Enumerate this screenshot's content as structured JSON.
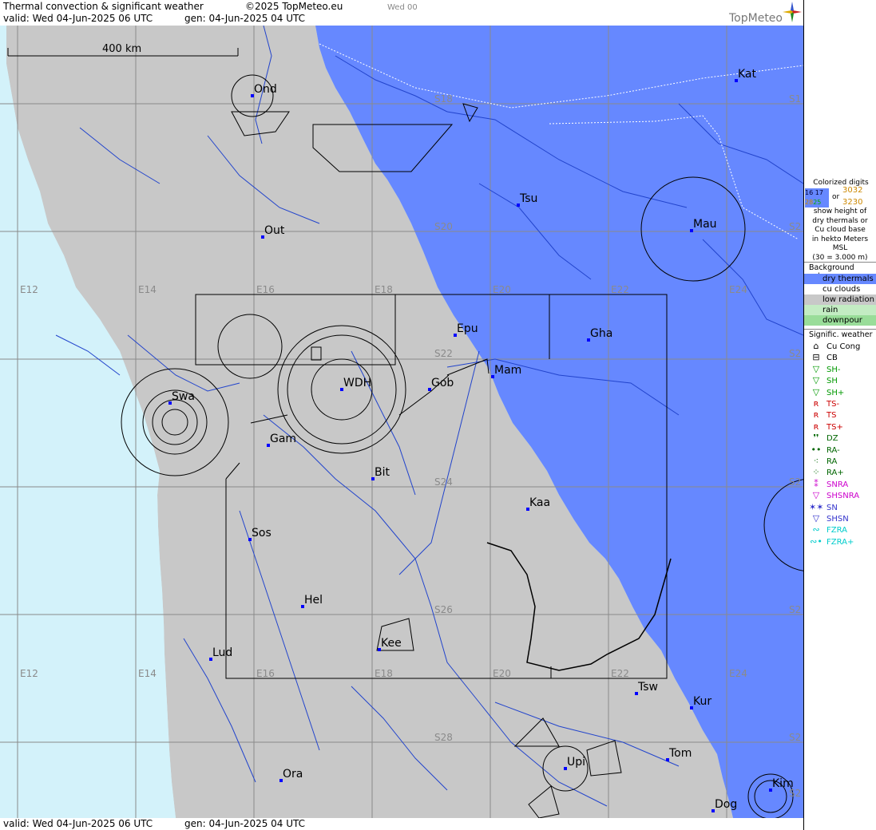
{
  "header": {
    "title": "Thermal convection & significant weather",
    "copyright": "©2025 TopMeteo.eu",
    "day_label": "Wed 00",
    "valid": "valid:  Wed  04-Jun-2025  06 UTC",
    "gen": "gen: 04-Jun-2025 04 UTC",
    "brand": "TopMeteo"
  },
  "scale": {
    "label": "400 km"
  },
  "stations": [
    {
      "code": "Ond"
    },
    {
      "code": "Out"
    },
    {
      "code": "Swa"
    },
    {
      "code": "WDH"
    },
    {
      "code": "Gam"
    },
    {
      "code": "Epu"
    },
    {
      "code": "Gob"
    },
    {
      "code": "Mam"
    },
    {
      "code": "Bit"
    },
    {
      "code": "Sos"
    },
    {
      "code": "Hel"
    },
    {
      "code": "Kee"
    },
    {
      "code": "Lud"
    },
    {
      "code": "Kaa"
    },
    {
      "code": "Tsu"
    },
    {
      "code": "Mau"
    },
    {
      "code": "Gha"
    },
    {
      "code": "Kat"
    },
    {
      "code": "Tsw"
    },
    {
      "code": "Kur"
    },
    {
      "code": "Tom"
    },
    {
      "code": "Upi"
    },
    {
      "code": "Ora"
    },
    {
      "code": "Dog"
    },
    {
      "code": "Kim"
    }
  ],
  "grid_labels": {
    "lon_top": [
      "E12",
      "E14",
      "E16",
      "E18",
      "E20",
      "E22",
      "E24"
    ],
    "lon_bottom": [
      "E12",
      "E14",
      "E16",
      "E18",
      "E20",
      "E22",
      "E24"
    ],
    "lat": [
      "S18",
      "S20",
      "S22",
      "S24",
      "S26",
      "S28"
    ],
    "lat_edge": [
      "S1",
      "S2",
      "S2",
      "S2",
      "S2",
      "S2",
      "S2"
    ]
  },
  "colors": {
    "sea": "#d3f2fa",
    "low_radiation": "#c8c8c8",
    "dry_thermals": "#6688ff",
    "rain": "#c3ecc3",
    "downpour": "#99dd99",
    "rivers": "#2244cc",
    "stations": "#0000ff"
  },
  "legend": {
    "digits_title": "Colorized digits",
    "digits_sample_left": [
      "16",
      "17",
      "28",
      "25"
    ],
    "digits_or": "or",
    "digits_sample_right": [
      "3032",
      "3230"
    ],
    "digits_text": [
      "show height of",
      "dry thermals or",
      "Cu cloud base",
      "in hekto Meters",
      "MSL",
      "(30 = 3.000 m)"
    ],
    "background_title": "Background color",
    "background_items": [
      {
        "label": "dry thermals",
        "color": "#6688ff"
      },
      {
        "label": "cu clouds",
        "color": "#ffffff"
      },
      {
        "label": "low radiation",
        "color": "#c8c8c8"
      },
      {
        "label": "rain",
        "color": "#c3ecc3"
      },
      {
        "label": "downpour",
        "color": "#99dd99"
      }
    ],
    "weather_title": "Signific. weather",
    "weather_items": [
      {
        "label": "Cu Cong",
        "icon": "cu-cong-icon",
        "color": "#000000"
      },
      {
        "label": "CB",
        "icon": "cb-icon",
        "color": "#000000"
      },
      {
        "label": "SH-",
        "icon": "shower-light-icon",
        "color": "#009900"
      },
      {
        "label": "SH",
        "icon": "shower-icon",
        "color": "#009900"
      },
      {
        "label": "SH+",
        "icon": "shower-heavy-icon",
        "color": "#009900"
      },
      {
        "label": "TS-",
        "icon": "thunderstorm-light-icon",
        "color": "#cc0000"
      },
      {
        "label": "TS",
        "icon": "thunderstorm-icon",
        "color": "#cc0000"
      },
      {
        "label": "TS+",
        "icon": "thunderstorm-heavy-icon",
        "color": "#cc0000"
      },
      {
        "label": "DZ",
        "icon": "drizzle-icon",
        "color": "#006600"
      },
      {
        "label": "RA-",
        "icon": "rain-light-icon",
        "color": "#006600"
      },
      {
        "label": "RA",
        "icon": "rain-icon",
        "color": "#006600"
      },
      {
        "label": "RA+",
        "icon": "rain-heavy-icon",
        "color": "#006600"
      },
      {
        "label": "SNRA",
        "icon": "snow-rain-icon",
        "color": "#cc00cc"
      },
      {
        "label": "SHSNRA",
        "icon": "snow-rain-shower-icon",
        "color": "#cc00cc"
      },
      {
        "label": "SN",
        "icon": "snow-icon",
        "color": "#3333cc"
      },
      {
        "label": "SHSN",
        "icon": "snow-shower-icon",
        "color": "#3333cc"
      },
      {
        "label": "FZRA",
        "icon": "freezing-rain-icon",
        "color": "#00cccc"
      },
      {
        "label": "FZRA+",
        "icon": "freezing-rain-heavy-icon",
        "color": "#00cccc"
      }
    ]
  }
}
